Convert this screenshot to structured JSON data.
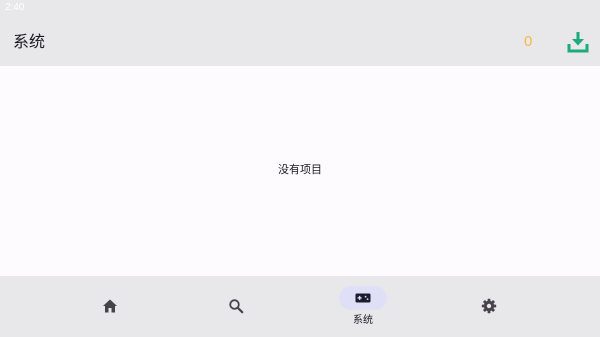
{
  "status_bar": {
    "time": "2:40"
  },
  "app_bar": {
    "title": "系统",
    "download_count": "0",
    "download_icon": "download-icon"
  },
  "content": {
    "empty_message": "没有项目"
  },
  "bottom_nav": {
    "items": [
      {
        "id": "home",
        "icon": "home-icon",
        "label": "",
        "selected": false
      },
      {
        "id": "search",
        "icon": "search-icon",
        "label": "",
        "selected": false
      },
      {
        "id": "systems",
        "icon": "gamepad-icon",
        "label": "系统",
        "selected": true
      },
      {
        "id": "settings",
        "icon": "gear-icon",
        "label": "",
        "selected": false
      }
    ]
  },
  "colors": {
    "bar_background": "#e8e7ea",
    "content_background": "#fdfbfe",
    "download_accent": "#1dab7a",
    "count_accent": "#f5b942",
    "selected_pill": "#dfe0f7",
    "icon": "#46444a"
  }
}
